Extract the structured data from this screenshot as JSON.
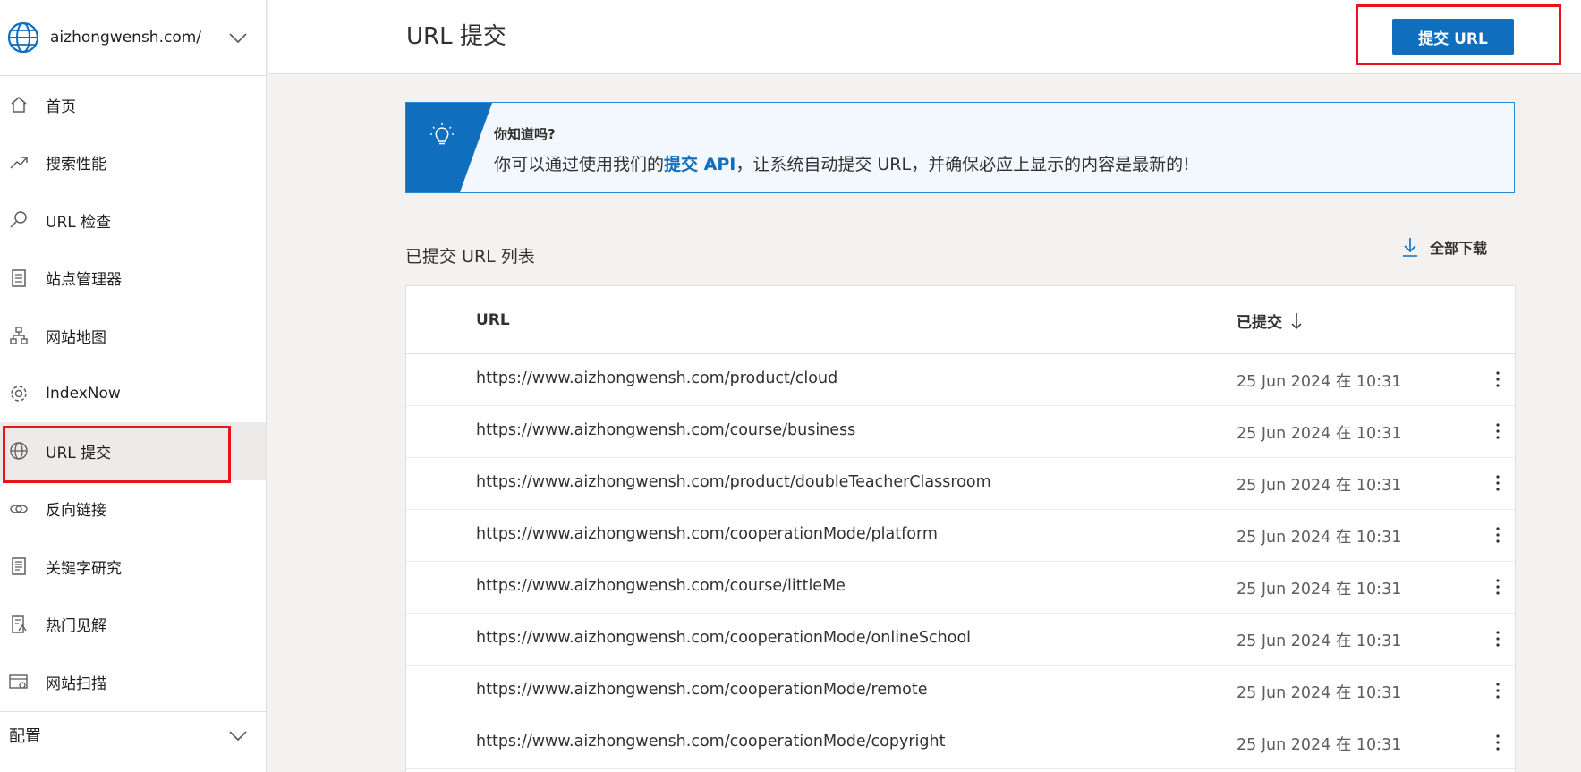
{
  "site": {
    "name": "aizhongwensh.com/"
  },
  "sidebar": {
    "items": [
      {
        "label": "首页",
        "icon": "home-icon"
      },
      {
        "label": "搜索性能",
        "icon": "trend-icon"
      },
      {
        "label": "URL 检查",
        "icon": "search-icon"
      },
      {
        "label": "站点管理器",
        "icon": "checklist-icon"
      },
      {
        "label": "网站地图",
        "icon": "sitemap-icon"
      },
      {
        "label": "IndexNow",
        "icon": "gear-icon"
      },
      {
        "label": "URL 提交",
        "icon": "globe-icon"
      },
      {
        "label": "反向链接",
        "icon": "link-icon"
      },
      {
        "label": "关键字研究",
        "icon": "document-icon"
      },
      {
        "label": "热门见解",
        "icon": "insights-icon"
      },
      {
        "label": "网站扫描",
        "icon": "scan-icon"
      }
    ],
    "config_label": "配置"
  },
  "header": {
    "title": "URL 提交",
    "submit_label": "提交 URL"
  },
  "banner": {
    "title": "你知道吗?",
    "text_before": "你可以通过使用我们的",
    "link": "提交 API",
    "text_after": "，让系统自动提交 URL，并确保必应上显示的内容是最新的!"
  },
  "list": {
    "title": "已提交 URL 列表",
    "download_label": "全部下载",
    "col_url": "URL",
    "col_submitted": "已提交",
    "rows": [
      {
        "url": "https://www.aizhongwensh.com/product/cloud",
        "date": "25 Jun 2024 在 10:31"
      },
      {
        "url": "https://www.aizhongwensh.com/course/business",
        "date": "25 Jun 2024 在 10:31"
      },
      {
        "url": "https://www.aizhongwensh.com/product/doubleTeacherClassroom",
        "date": "25 Jun 2024 在 10:31"
      },
      {
        "url": "https://www.aizhongwensh.com/cooperationMode/platform",
        "date": "25 Jun 2024 在 10:31"
      },
      {
        "url": "https://www.aizhongwensh.com/course/littleMe",
        "date": "25 Jun 2024 在 10:31"
      },
      {
        "url": "https://www.aizhongwensh.com/cooperationMode/onlineSchool",
        "date": "25 Jun 2024 在 10:31"
      },
      {
        "url": "https://www.aizhongwensh.com/cooperationMode/remote",
        "date": "25 Jun 2024 在 10:31"
      },
      {
        "url": "https://www.aizhongwensh.com/cooperationMode/copyright",
        "date": "25 Jun 2024 在 10:31"
      }
    ]
  },
  "colors": {
    "accent": "#106ebe",
    "highlight": "#e8141c",
    "banner_bg": "#f2f8fd"
  }
}
